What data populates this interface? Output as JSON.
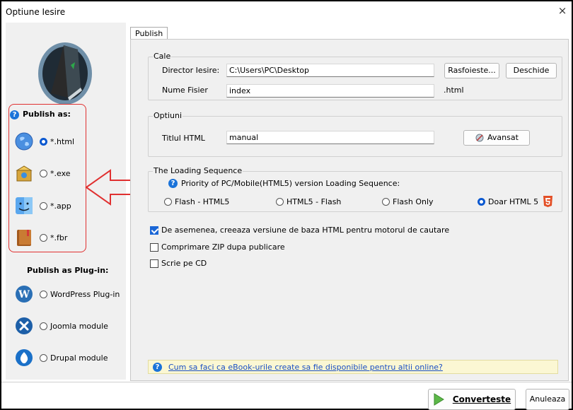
{
  "window": {
    "title": "Optiune Iesire",
    "close": "×"
  },
  "sidebar": {
    "publish_as_label": "Publish as:",
    "publish_options": [
      {
        "label": "*.html",
        "selected": true,
        "icon": "globe-icon"
      },
      {
        "label": "*.exe",
        "selected": false,
        "icon": "setup-box-icon"
      },
      {
        "label": "*.app",
        "selected": false,
        "icon": "mac-finder-icon"
      },
      {
        "label": "*.fbr",
        "selected": false,
        "icon": "book-icon"
      }
    ],
    "plugin_label": "Publish as Plug-in:",
    "plugin_options": [
      {
        "label": "WordPress Plug-in",
        "selected": false,
        "icon": "wordpress-icon"
      },
      {
        "label": "Joomla module",
        "selected": false,
        "icon": "joomla-icon"
      },
      {
        "label": "Drupal module",
        "selected": false,
        "icon": "drupal-icon"
      }
    ]
  },
  "tabs": [
    {
      "label": "Publish",
      "active": true
    }
  ],
  "cale": {
    "title": "Cale",
    "dir_label": "Director Iesire:",
    "dir_value": "C:\\Users\\PC\\Desktop",
    "browse_label": "Rasfoieste...",
    "open_label": "Deschide",
    "file_label": "Nume Fisier",
    "file_value": "index",
    "ext": ".html"
  },
  "optiuni": {
    "title": "Optiuni",
    "html_title_label": "Titlul HTML",
    "html_title_value": "manual",
    "advanced_label": "Avansat"
  },
  "loading": {
    "title": "The Loading Sequence",
    "priority_label": "Priority of PC/Mobile(HTML5) version Loading Sequence:",
    "options": [
      {
        "label": "Flash - HTML5",
        "selected": false
      },
      {
        "label": "HTML5 - Flash",
        "selected": false
      },
      {
        "label": "Flash Only",
        "selected": false
      },
      {
        "label": "Doar HTML 5",
        "selected": true
      }
    ]
  },
  "checks": [
    {
      "label": "De asemenea, creeaza versiune de baza HTML pentru motorul de cautare",
      "checked": true
    },
    {
      "label": "Comprimare ZIP dupa publicare",
      "checked": false
    },
    {
      "label": "Scrie pe CD",
      "checked": false
    }
  ],
  "help_link": "Cum sa faci ca eBook-urile create sa fie disponibile pentru altii online?",
  "footer": {
    "convert_label": "Converteste",
    "cancel_label": "Anuleaza"
  },
  "colors": {
    "accent": "#0a58d0",
    "annotation_red": "#e03030",
    "help_bg": "#fbf7d3"
  }
}
